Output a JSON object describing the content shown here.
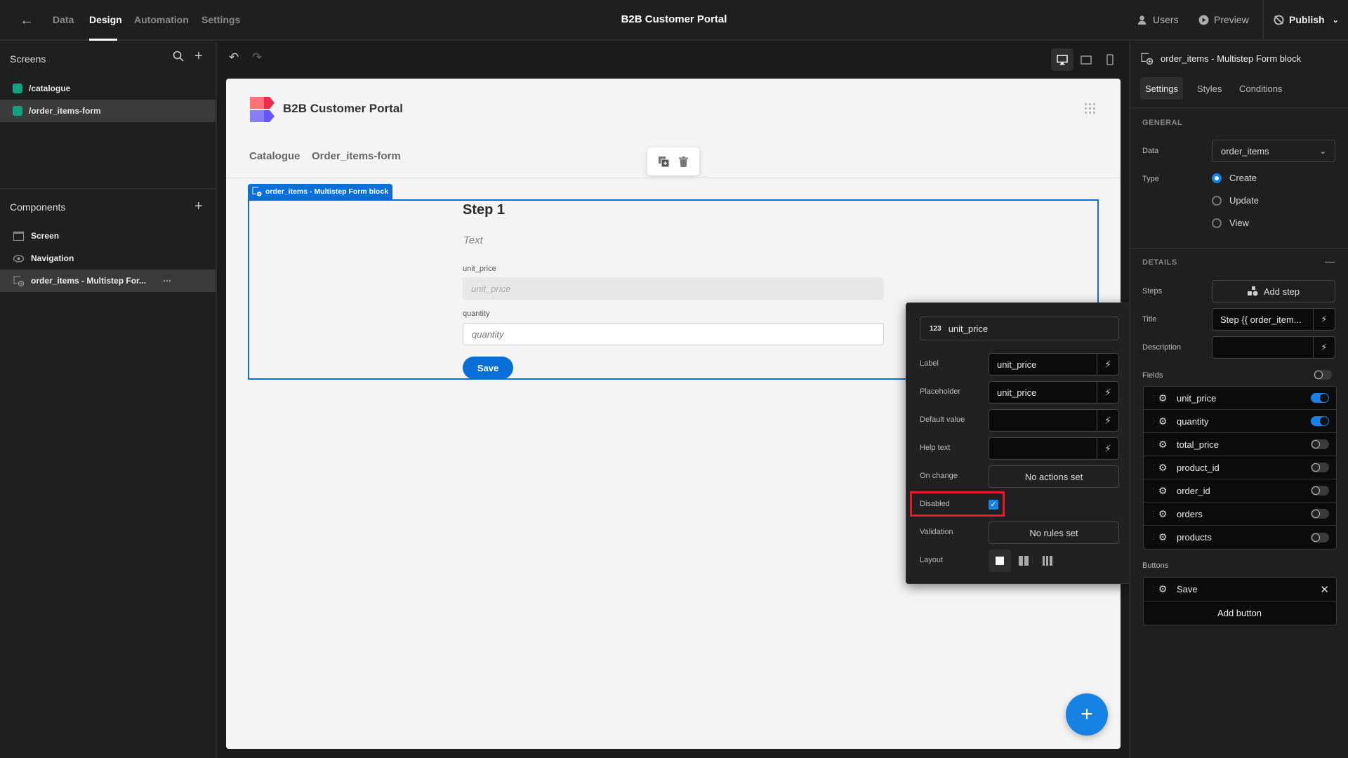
{
  "topbar": {
    "nav_tabs": [
      {
        "label": "Data"
      },
      {
        "label": "Design",
        "active": true
      },
      {
        "label": "Automation"
      },
      {
        "label": "Settings"
      }
    ],
    "app_title": "B2B Customer Portal",
    "users_label": "Users",
    "preview_label": "Preview",
    "publish_label": "Publish"
  },
  "screens": {
    "heading": "Screens",
    "items": [
      {
        "label": "/catalogue",
        "selected": false
      },
      {
        "label": "/order_items-form",
        "selected": true
      }
    ]
  },
  "components": {
    "heading": "Components",
    "items": [
      {
        "label": "Screen",
        "icon": "screen-icon"
      },
      {
        "label": "Navigation",
        "icon": "eye-icon"
      },
      {
        "label": "order_items - Multistep For...",
        "icon": "form-block-icon",
        "selected": true
      }
    ]
  },
  "canvas": {
    "page_title": "B2B Customer Portal",
    "nav_links": [
      "Catalogue",
      "Order_items-form"
    ],
    "block_label": "order_items - Multistep Form block",
    "step_title": "Step 1",
    "step_description": "Text",
    "fields": [
      {
        "label": "unit_price",
        "placeholder": "unit_price",
        "disabled": true
      },
      {
        "label": "quantity",
        "placeholder": "quantity",
        "disabled": false
      }
    ],
    "save_button": "Save"
  },
  "field_popover": {
    "field_type_badge": "123",
    "field_name": "unit_price",
    "rows": {
      "label": {
        "label": "Label",
        "value": "unit_price"
      },
      "placeholder": {
        "label": "Placeholder",
        "value": "unit_price"
      },
      "default_value": {
        "label": "Default value",
        "value": ""
      },
      "help_text": {
        "label": "Help text",
        "value": ""
      },
      "on_change": {
        "label": "On change",
        "value": "No actions set"
      },
      "disabled": {
        "label": "Disabled",
        "checked": true
      },
      "validation": {
        "label": "Validation",
        "value": "No rules set"
      },
      "layout": {
        "label": "Layout",
        "options": [
          "single-column",
          "two-column",
          "three-column"
        ],
        "selected": "single-column"
      }
    }
  },
  "settings_panel": {
    "title": "order_items - Multistep Form block",
    "tabs": [
      {
        "label": "Settings",
        "active": true
      },
      {
        "label": "Styles"
      },
      {
        "label": "Conditions"
      }
    ],
    "general": {
      "heading": "GENERAL",
      "data_label": "Data",
      "data_value": "order_items",
      "type_label": "Type",
      "type_options": [
        {
          "label": "Create",
          "selected": true
        },
        {
          "label": "Update",
          "selected": false
        },
        {
          "label": "View",
          "selected": false
        }
      ]
    },
    "details": {
      "heading": "DETAILS",
      "steps_label": "Steps",
      "add_step": "Add step",
      "title_label": "Title",
      "title_value": "Step {{ order_item...",
      "description_label": "Description",
      "description_value": "",
      "fields_label": "Fields",
      "fields_all_on": false,
      "fields": [
        {
          "name": "unit_price",
          "enabled": true
        },
        {
          "name": "quantity",
          "enabled": true
        },
        {
          "name": "total_price",
          "enabled": false
        },
        {
          "name": "product_id",
          "enabled": false
        },
        {
          "name": "order_id",
          "enabled": false
        },
        {
          "name": "orders",
          "enabled": false
        },
        {
          "name": "products",
          "enabled": false
        }
      ],
      "buttons_label": "Buttons",
      "buttons": [
        {
          "name": "Save"
        }
      ],
      "add_button": "Add button"
    }
  },
  "colors": {
    "accent": "#1582e4",
    "block_outline": "#0a6fd6",
    "screen_badge": "#12a37e",
    "highlight": "#e8192c"
  }
}
